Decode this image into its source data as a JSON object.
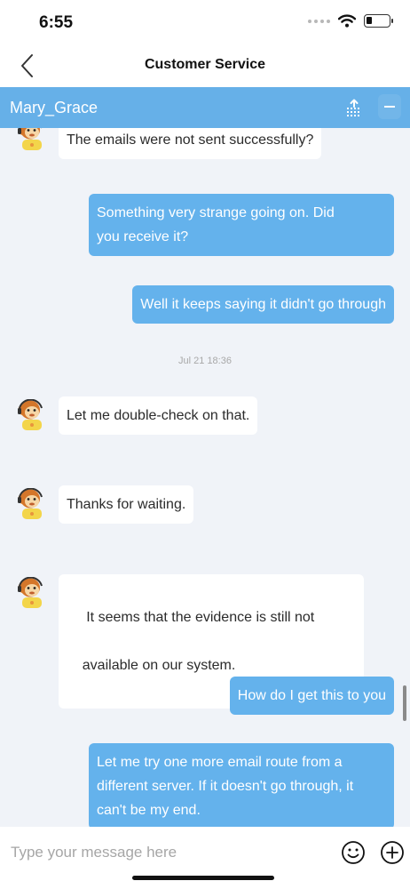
{
  "status_bar": {
    "time": "6:55"
  },
  "nav": {
    "title": "Customer Service"
  },
  "agent": {
    "name": "Mary_Grace"
  },
  "messages": [
    {
      "side": "in",
      "text": "The emails were not sent successfully?"
    },
    {
      "side": "out",
      "lines": [
        "Something very strange going on. Did",
        "you receive it?"
      ]
    },
    {
      "side": "out",
      "text": "Well it keeps saying it didn't go through"
    },
    {
      "side": "time",
      "text": "Jul 21 18:36"
    },
    {
      "side": "in",
      "text": "Let me double-check on that."
    },
    {
      "side": "in",
      "text": "Thanks for waiting."
    },
    {
      "side": "in",
      "lines": [
        " It seems that the evidence is still not",
        "available on our system."
      ]
    },
    {
      "side": "out",
      "text": "How do I get this to you"
    },
    {
      "side": "out",
      "lines": [
        "Let me try one more email route from a",
        "different server. If it doesn't go through, it",
        "can't be my end."
      ]
    }
  ],
  "input": {
    "placeholder": "Type your message here"
  },
  "colors": {
    "agent_bar": "#66b0e8",
    "outgoing_bubble": "#64b2ec",
    "chat_background": "#f0f3f8"
  },
  "icons": {
    "back": "chevron-left-icon",
    "tray": "tray-icon",
    "emoji": "smiley-icon",
    "add": "plus-circle-icon",
    "avatar": "monkey-avatar-icon"
  }
}
